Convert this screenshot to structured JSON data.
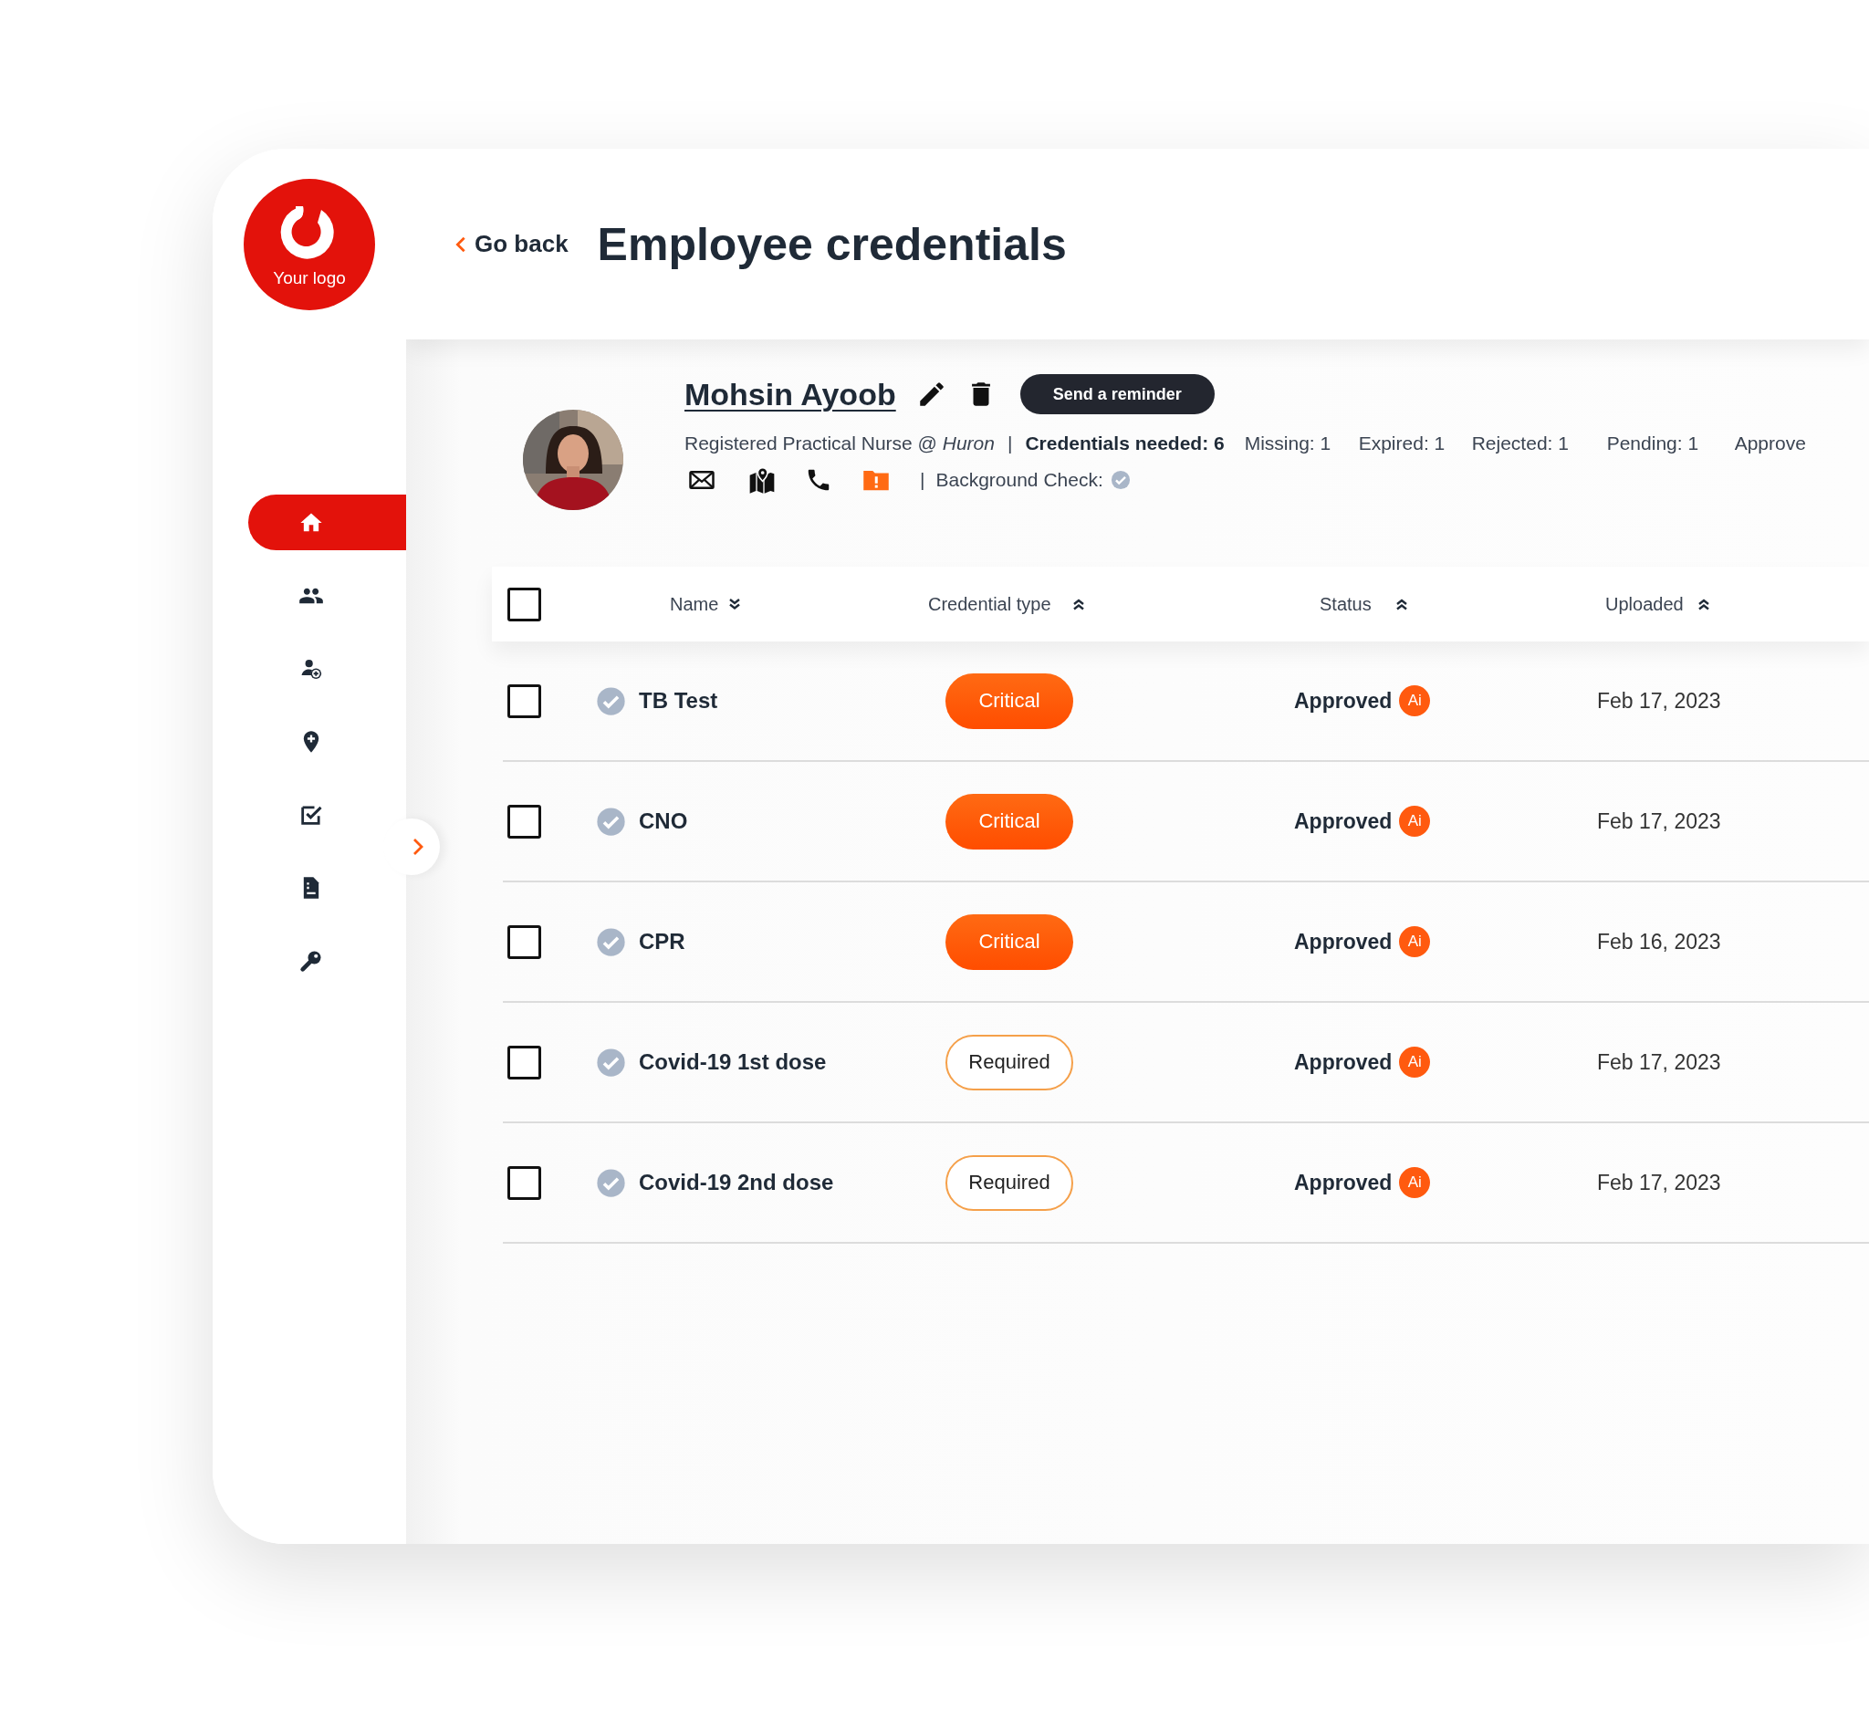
{
  "logo": {
    "text": "Your logo"
  },
  "sidebar": {
    "items": [
      {
        "kind": "home",
        "selected": true
      },
      {
        "kind": "people",
        "selected": false
      },
      {
        "kind": "add-person",
        "selected": false
      },
      {
        "kind": "add-location",
        "selected": false
      },
      {
        "kind": "checklist",
        "selected": false
      },
      {
        "kind": "document",
        "selected": false
      },
      {
        "kind": "key",
        "selected": false
      }
    ]
  },
  "header": {
    "back_link": "Go back",
    "title": "Employee credentials"
  },
  "profile": {
    "name": "Mohsin Ayoob",
    "reminder_button": "Send a reminder",
    "role": "Registered Practical Nurse @ *Huron*",
    "separator": "|",
    "credentials_needed": "Credentials needed: 6",
    "counts": [
      "Missing: 1",
      "Expired: 1",
      "Rejected: 1",
      "Pending: 1",
      "Approve"
    ],
    "contacts": [
      {
        "kind": "email"
      },
      {
        "kind": "map"
      },
      {
        "kind": "phone"
      },
      {
        "kind": "alert-folder"
      }
    ],
    "contacts_separator": "|",
    "background_check": "Background Check:",
    "background_verified": true
  },
  "table": {
    "select_all": {
      "checked": false
    },
    "columns": [
      {
        "label": "Name",
        "sort_descending": true
      },
      {
        "label": "Credential type",
        "sort_descending": false
      },
      {
        "label": "Status",
        "sort_descending": false
      },
      {
        "label": "Uploaded",
        "sort_descending": false
      }
    ],
    "rows": [
      {
        "checked": false,
        "verified": true,
        "name": "TB Test",
        "credential_type": {
          "label": "Critical",
          "kind": "critical"
        },
        "status": "Approved",
        "ai_badge": "Ai",
        "uploaded": "Feb 17, 2023"
      },
      {
        "checked": false,
        "verified": true,
        "name": "CNO",
        "credential_type": {
          "label": "Critical",
          "kind": "critical"
        },
        "status": "Approved",
        "ai_badge": "Ai",
        "uploaded": "Feb 17, 2023"
      },
      {
        "checked": false,
        "verified": true,
        "name": "CPR",
        "credential_type": {
          "label": "Critical",
          "kind": "critical"
        },
        "status": "Approved",
        "ai_badge": "Ai",
        "uploaded": "Feb 16, 2023"
      },
      {
        "checked": false,
        "verified": true,
        "name": "Covid-19 1st dose",
        "credential_type": {
          "label": "Required",
          "kind": "required"
        },
        "status": "Approved",
        "ai_badge": "Ai",
        "uploaded": "Feb 17, 2023"
      },
      {
        "checked": false,
        "verified": true,
        "name": "Covid-19 2nd dose",
        "credential_type": {
          "label": "Required",
          "kind": "required"
        },
        "status": "Approved",
        "ai_badge": "Ai",
        "uploaded": "Feb 17, 2023"
      }
    ]
  }
}
